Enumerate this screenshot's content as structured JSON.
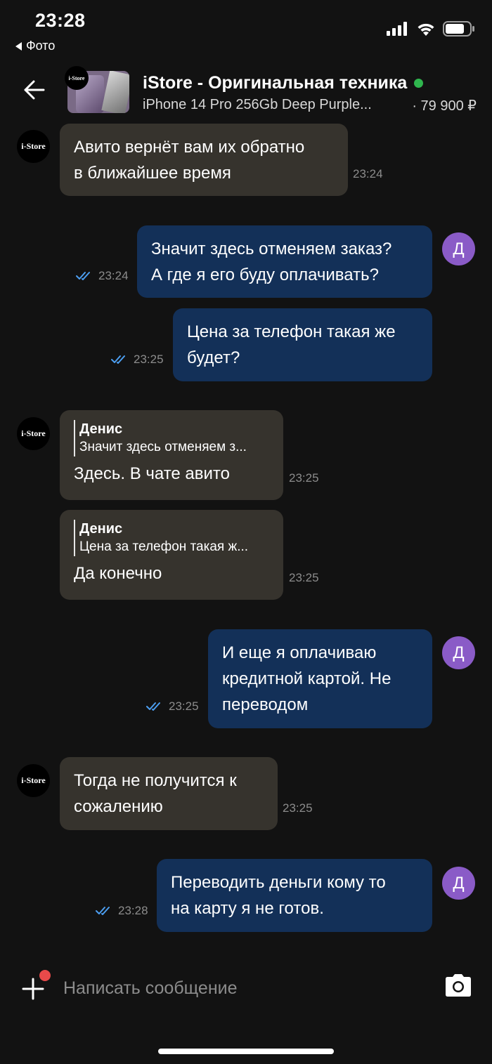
{
  "status_bar": {
    "time": "23:28",
    "back_app": "Фото"
  },
  "header": {
    "title": "iStore - Оригинальная техника",
    "subtitle": "iPhone 14 Pro 256Gb Deep Purple...",
    "price": "· 79 900 ₽",
    "thumb_logo": "i-Store",
    "online_color": "#2fb64e"
  },
  "avatars": {
    "seller": "i-Store",
    "me": "Д"
  },
  "messages": [
    {
      "side": "in",
      "lines": [
        "Авито вернёт вам их обратно",
        "в ближайшее время"
      ],
      "time": "23:24"
    },
    {
      "side": "out",
      "lines": [
        "Значит здесь отменяем заказ?",
        "А где я его буду оплачивать?"
      ],
      "time": "23:24"
    },
    {
      "side": "out",
      "lines": [
        "Цена за телефон такая же",
        "будет?"
      ],
      "time": "23:25"
    },
    {
      "side": "in",
      "quote_name": "Денис",
      "quote_text": "Значит здесь отменяем з...",
      "lines": [
        "Здесь. В чате авито"
      ],
      "time": "23:25"
    },
    {
      "side": "in",
      "quote_name": "Денис",
      "quote_text": "Цена за телефон такая ж...",
      "lines": [
        "Да конечно"
      ],
      "time": "23:25"
    },
    {
      "side": "out",
      "lines": [
        "И еще я оплачиваю",
        "кредитной картой. Не",
        "переводом"
      ],
      "time": "23:25"
    },
    {
      "side": "in",
      "lines": [
        "Тогда не получится к",
        "сожалению"
      ],
      "time": "23:25"
    },
    {
      "side": "out",
      "lines": [
        "Переводить деньги кому то",
        "на карту я не готов."
      ],
      "time": "23:28"
    }
  ],
  "input": {
    "placeholder": "Написать сообщение"
  },
  "colors": {
    "incoming_bubble": "#36332d",
    "outgoing_bubble": "#133058",
    "read_checks": "#4c9ef0",
    "avatar_me": "#8a5bc7"
  },
  "icons": [
    "back-arrow-icon",
    "signal-icon",
    "wifi-icon",
    "battery-icon",
    "plus-icon",
    "camera-icon",
    "double-check-icon"
  ]
}
